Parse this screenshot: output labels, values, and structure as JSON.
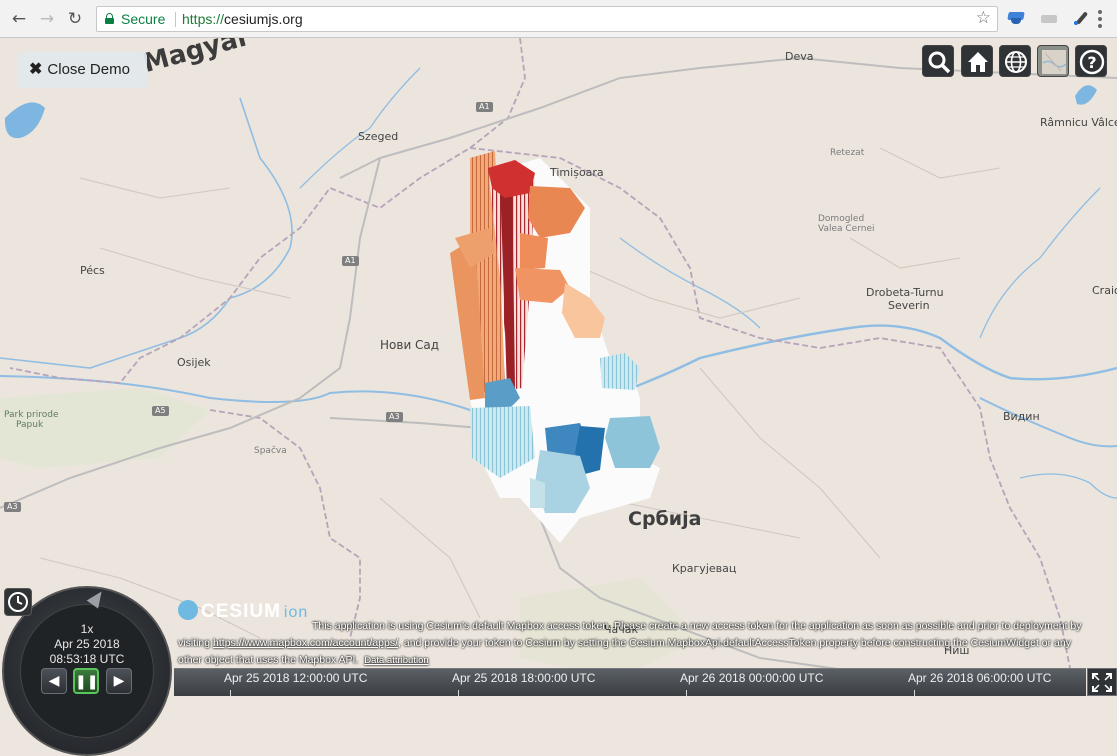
{
  "browser": {
    "secure_label": "Secure",
    "url_scheme": "https://",
    "url_host": "cesiumjs.org",
    "icons": [
      "back-arrow-icon",
      "forward-arrow-icon",
      "reload-icon",
      "lock-icon",
      "bookmark-star-icon",
      "graduation-cap-icon",
      "gray-extension-icon",
      "eyedropper-icon",
      "more-menu-icon"
    ]
  },
  "demo": {
    "close_label": "Close Demo"
  },
  "toolbar": {
    "icons": [
      "search-icon",
      "home-icon",
      "globe-icon",
      "map-layers-icon",
      "help-icon"
    ],
    "help_glyph": "?"
  },
  "map": {
    "labels": {
      "magyar": "Magyar",
      "szeged": "Szeged",
      "timisoara": "Timișoara",
      "deva": "Deva",
      "pecs": "Pécs",
      "osijek": "Osijek",
      "novi_sad": "Нови Сад",
      "srbija": "Србија",
      "kragujevac": "Крагујевац",
      "drobeta": "Drobeta-Turnu",
      "severin": "Severin",
      "vidin": "Видин",
      "ramnicu": "Râmnicu Vâlcea",
      "craio": "Craio",
      "retezat": "Retezat",
      "domogled": "Domogled",
      "valea": "Valea Cernei",
      "park1": "Park prirode",
      "park2": "Papuk",
      "spacva": "Spačva",
      "cacak": "Чачак",
      "nis": "Ниш",
      "road_a1_top": "A1",
      "road_a1_mid": "A1",
      "road_a3": "A3",
      "road_a5": "A5",
      "road_a3_left": "A3"
    }
  },
  "credits": {
    "logo_text": "CESIUM",
    "logo_suffix": "ion",
    "line1": "This application is using Cesium's default Mapbox access token. Please create a new access token for the application as soon as possible and prior to deployment by",
    "line2a": "visiting ",
    "line2_link": "https://www.mapbox.com/account/apps/",
    "line2b": ", and provide your token to Cesium by setting the Cesium.MapboxApi.defaultAccessToken property before constructing the CesiumWidget or any",
    "line3": "other object that uses the Mapbox API.",
    "attribution": "Data attribution"
  },
  "animation": {
    "speed": "1x",
    "date": "Apr 25 2018",
    "time": "08:53:18 UTC",
    "icons": [
      "play-reverse-icon",
      "pause-icon",
      "play-forward-icon",
      "clock-icon"
    ]
  },
  "timeline": {
    "labels": [
      "Apr 25 2018 12:00:00 UTC",
      "Apr 25 2018 18:00:00 UTC",
      "Apr 26 2018 00:00:00 UTC",
      "Apr 26 2018 06:00:00 UTC"
    ],
    "fullscreen_icon": "fullscreen-icon"
  },
  "colors": {
    "extrusion_warm": [
      "#b52a31",
      "#d8603f",
      "#ee8e5c",
      "#f6bf93",
      "#fdd9bd"
    ],
    "extrusion_cool": [
      "#c7e3ec",
      "#9ccde0",
      "#5ea7cc",
      "#2a7bb5"
    ],
    "secure_green": "#0b8043",
    "widget_dark": "#303336"
  }
}
